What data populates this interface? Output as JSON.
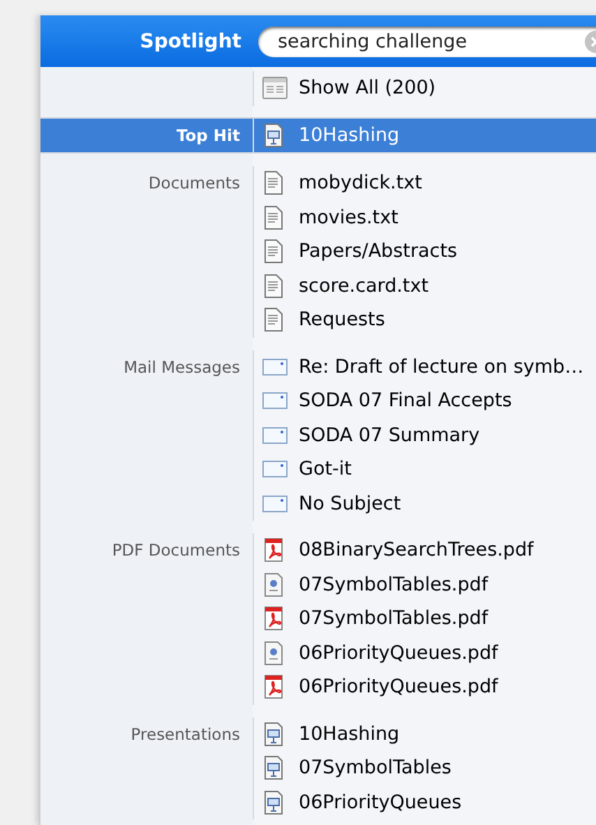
{
  "header": {
    "title": "Spotlight",
    "query": "searching challenge"
  },
  "show_all": {
    "text": "Show All (200)",
    "kind": "list",
    "selected": false
  },
  "sections": [
    {
      "label": "Top Hit",
      "items": [
        {
          "text": "10Hashing",
          "kind": "presentation",
          "selected": true
        }
      ]
    },
    {
      "label": "Documents",
      "items": [
        {
          "text": "mobydick.txt",
          "kind": "text",
          "selected": false
        },
        {
          "text": "movies.txt",
          "kind": "text",
          "selected": false
        },
        {
          "text": "Papers/Abstracts",
          "kind": "text",
          "selected": false
        },
        {
          "text": "score.card.txt",
          "kind": "text",
          "selected": false
        },
        {
          "text": "Requests",
          "kind": "text",
          "selected": false
        }
      ]
    },
    {
      "label": "Mail Messages",
      "items": [
        {
          "text": "Re: Draft of lecture on symb…",
          "kind": "mail",
          "selected": false
        },
        {
          "text": "SODA 07 Final Accepts",
          "kind": "mail",
          "selected": false
        },
        {
          "text": "SODA 07 Summary",
          "kind": "mail",
          "selected": false
        },
        {
          "text": "Got-it",
          "kind": "mail",
          "selected": false
        },
        {
          "text": "No Subject",
          "kind": "mail",
          "selected": false
        }
      ]
    },
    {
      "label": "PDF Documents",
      "items": [
        {
          "text": "08BinarySearchTrees.pdf",
          "kind": "acrobat",
          "selected": false
        },
        {
          "text": "07SymbolTables.pdf",
          "kind": "preview",
          "selected": false
        },
        {
          "text": "07SymbolTables.pdf",
          "kind": "acrobat",
          "selected": false
        },
        {
          "text": "06PriorityQueues.pdf",
          "kind": "preview",
          "selected": false
        },
        {
          "text": "06PriorityQueues.pdf",
          "kind": "acrobat",
          "selected": false
        }
      ]
    },
    {
      "label": "Presentations",
      "items": [
        {
          "text": "10Hashing",
          "kind": "presentation",
          "selected": false
        },
        {
          "text": "07SymbolTables",
          "kind": "presentation",
          "selected": false
        },
        {
          "text": "06PriorityQueues",
          "kind": "presentation",
          "selected": false
        }
      ]
    }
  ]
}
